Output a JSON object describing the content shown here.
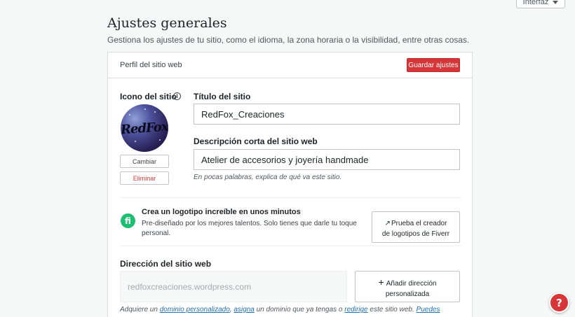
{
  "topbar": {
    "interface_label": "Interfaz"
  },
  "page": {
    "title": "Ajustes generales",
    "subtitle": "Gestiona los ajustes de tu sitio, como el idioma, la zona horaria o la visibilidad, entre otras cosas."
  },
  "card": {
    "header_title": "Perfil del sitio web",
    "save_label": "Guardar ajustes"
  },
  "site_icon": {
    "label": "Icono del sitio",
    "info_glyph": "i",
    "logo_text": "RedFox",
    "change_label": "Cambiar",
    "delete_label": "Eliminar"
  },
  "site_title": {
    "label": "Título del sitio",
    "value": "RedFox_Creaciones"
  },
  "tagline": {
    "label": "Descripción corta del sitio web",
    "value": "Atelier de accesorios y joyería handmade",
    "hint": "En pocas palabras, explica de qué va este sitio."
  },
  "fiverr": {
    "icon_glyph": "fi",
    "title": "Crea un logotipo increíble en unos minutos",
    "text": "Pre-diseñado por los mejores talentos. Solo tienes que darle tu toque personal.",
    "button_line1": "Prueba el creador",
    "button_line2": "de logotipos de Fiverr"
  },
  "address": {
    "label": "Dirección del sitio web",
    "value": "redfoxcreaciones.wordpress.com",
    "add_line1": "Añadir dirección",
    "add_line2": "personalizada"
  },
  "footer_note": {
    "part1": "Adquiere un ",
    "link1": "dominio personalizado",
    "part2": ", ",
    "link2": "asigna",
    "part3": " un dominio que ya tengas o ",
    "link3": "redirige",
    "part4": " este sitio web. ",
    "link4": "Puedes"
  },
  "help": {
    "glyph": "?"
  },
  "colors": {
    "accent": "#d63638",
    "link": "#2271b1",
    "fiverr": "#1dbf73"
  }
}
